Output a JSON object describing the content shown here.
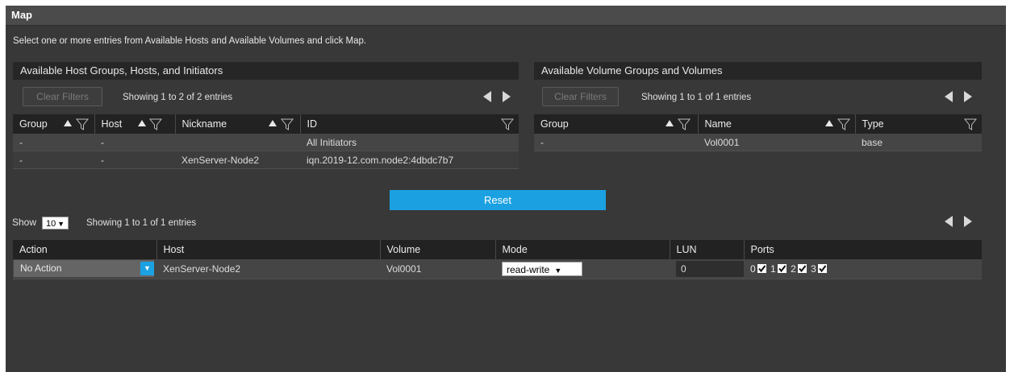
{
  "panel": {
    "title": "Map"
  },
  "instructions": "Select one or more entries from Available Hosts and Available Volumes and click Map.",
  "hosts": {
    "header": "Available Host Groups, Hosts, and Initiators",
    "clear_filters": "Clear Filters",
    "showing": "Showing 1 to 2 of 2 entries",
    "columns": {
      "group": "Group",
      "host": "Host",
      "nickname": "Nickname",
      "id": "ID"
    },
    "rows": [
      {
        "group": "-",
        "host": "-",
        "nickname": "",
        "id": "All Initiators"
      },
      {
        "group": "-",
        "host": "-",
        "nickname": "XenServer-Node2",
        "id": "iqn.2019-12.com.node2:4dbdc7b7"
      }
    ]
  },
  "volumes": {
    "header": "Available Volume Groups and Volumes",
    "clear_filters": "Clear Filters",
    "showing": "Showing 1 to 1 of 1 entries",
    "columns": {
      "group": "Group",
      "name": "Name",
      "type": "Type"
    },
    "rows": [
      {
        "group": "-",
        "name": "Vol0001",
        "type": "base"
      }
    ]
  },
  "reset_label": "Reset",
  "mappings": {
    "show_label": "Show",
    "page_size": "10",
    "showing": "Showing 1 to 1 of 1 entries",
    "columns": {
      "action": "Action",
      "host": "Host",
      "volume": "Volume",
      "mode": "Mode",
      "lun": "LUN",
      "ports": "Ports"
    },
    "rows": [
      {
        "action": "No Action",
        "host": "XenServer-Node2",
        "volume": "Vol0001",
        "mode": "read-write",
        "lun": "0",
        "ports": [
          {
            "label": "0",
            "checked": true
          },
          {
            "label": "1",
            "checked": true
          },
          {
            "label": "2",
            "checked": true
          },
          {
            "label": "3",
            "checked": true
          }
        ]
      }
    ]
  },
  "colors": {
    "accent": "#1ba1e2",
    "panel_bg": "#383838",
    "header_bg": "#262626"
  }
}
